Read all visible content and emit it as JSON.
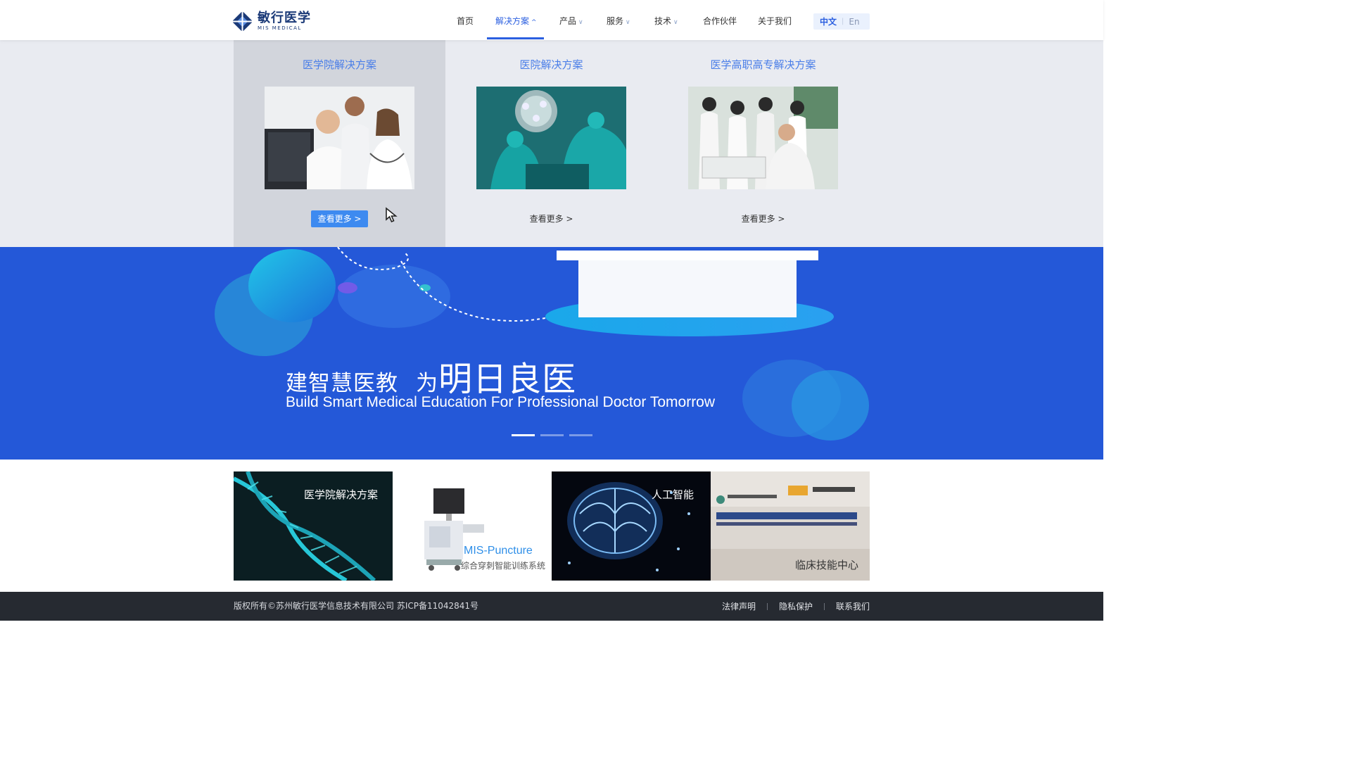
{
  "logo": {
    "cn": "敏行医学",
    "en": "MIS MEDICAL"
  },
  "nav": {
    "items": [
      {
        "label": "首页",
        "has_dropdown": false
      },
      {
        "label": "解决方案",
        "has_dropdown": true,
        "active": true
      },
      {
        "label": "产品",
        "has_dropdown": true
      },
      {
        "label": "服务",
        "has_dropdown": true
      },
      {
        "label": "技术",
        "has_dropdown": true
      },
      {
        "label": "合作伙伴",
        "has_dropdown": false
      },
      {
        "label": "关于我们",
        "has_dropdown": false
      }
    ],
    "chevron_down": "⌵",
    "chevron_up": "︿"
  },
  "lang": {
    "zh": "中文",
    "sep": "|",
    "en": "En"
  },
  "dropdown": {
    "columns": [
      {
        "title": "医学院解决方案",
        "more": "查看更多 >",
        "image": "doctors-at-computer"
      },
      {
        "title": "医院解决方案",
        "more": "查看更多 >",
        "image": "surgery-operating-room"
      },
      {
        "title": "医学高职高专解决方案",
        "more": "查看更多 >",
        "image": "students-lab-training"
      }
    ]
  },
  "banner": {
    "title_small": "建智慧医教",
    "title_small2": "为",
    "title_big": "明日良医",
    "subtitle": "Build Smart Medical Education For Professional Doctor Tomorrow",
    "slides": 3,
    "active_slide": 1
  },
  "cards": [
    {
      "label": "医学院解决方案",
      "image": "dna-helix"
    },
    {
      "label": "MIS-Puncture",
      "sublabel": "综合穿刺智能训练系统",
      "image": "puncture-trainer-device"
    },
    {
      "label": "人工智能",
      "image": "glowing-brain"
    },
    {
      "label": "临床技能中心",
      "image": "clinical-skills-center-wall"
    }
  ],
  "footer": {
    "copyright": "版权所有©苏州敏行医学信息技术有限公司  苏ICP备11042841号",
    "links": [
      "法律声明",
      "隐私保护",
      "联系我们"
    ]
  },
  "colors": {
    "primary": "#2b5fe0",
    "banner_bg": "#2458d8",
    "footer_bg": "#262a31",
    "button": "#3d8af0"
  }
}
